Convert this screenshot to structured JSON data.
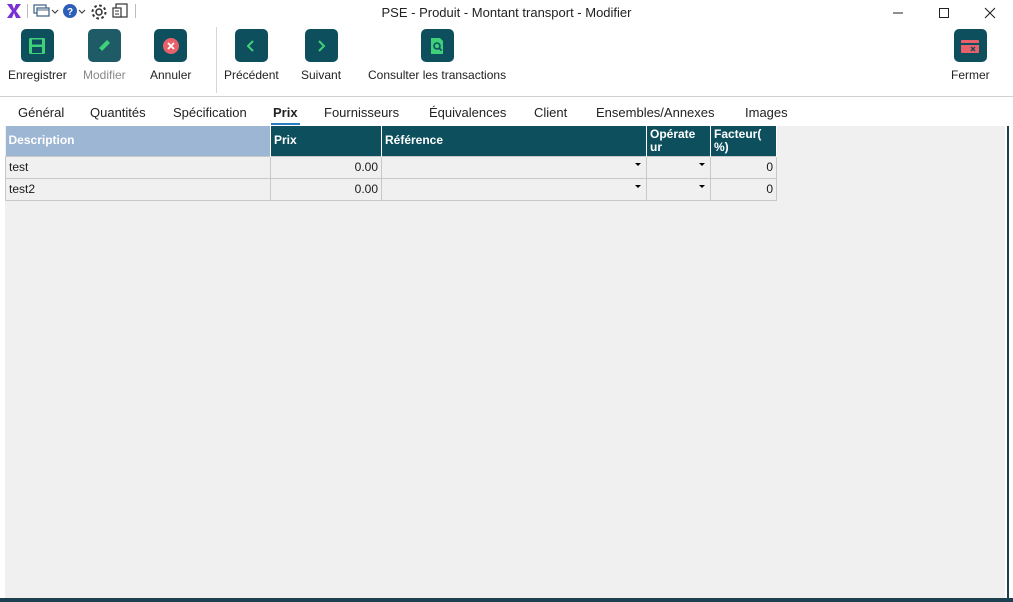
{
  "window": {
    "title": "PSE - Produit - Montant transport - Modifier"
  },
  "quick_access": {
    "icons": [
      "app-logo-icon",
      "windows-icon",
      "help-icon",
      "settings-icon",
      "document-icon"
    ]
  },
  "ribbon": {
    "save_label": "Enregistrer",
    "edit_label": "Modifier",
    "cancel_label": "Annuler",
    "previous_label": "Précédent",
    "next_label": "Suivant",
    "transactions_label": "Consulter les transactions",
    "close_label": "Fermer"
  },
  "tabs": [
    {
      "label": "Général",
      "active": false
    },
    {
      "label": "Quantités",
      "active": false
    },
    {
      "label": "Spécification",
      "active": false
    },
    {
      "label": "Prix",
      "active": true
    },
    {
      "label": "Fournisseurs",
      "active": false
    },
    {
      "label": "Équivalences",
      "active": false
    },
    {
      "label": "Client",
      "active": false
    },
    {
      "label": "Ensembles/Annexes",
      "active": false
    },
    {
      "label": "Images",
      "active": false
    }
  ],
  "grid": {
    "columns": [
      "Description",
      "Prix",
      "Référence",
      "Opérate ur",
      "Facteur( %)"
    ],
    "columns_display": {
      "operateur_line1": "Opérate",
      "operateur_line2": "ur",
      "facteur_line1": "Facteur(",
      "facteur_line2": "%)"
    },
    "rows": [
      {
        "description": "test",
        "prix": "0.00",
        "reference": "",
        "operateur": "",
        "facteur": "0"
      },
      {
        "description": "test2",
        "prix": "0.00",
        "reference": "",
        "operateur": "",
        "facteur": "0"
      }
    ]
  },
  "colors": {
    "accent": "#0e4f5e",
    "header_selected": "#9db6d3",
    "tab_underline": "#2a7fc0",
    "cancel_icon": "#e8606a",
    "save_icon": "#3fd07a",
    "close_icon": "#e8606a"
  }
}
